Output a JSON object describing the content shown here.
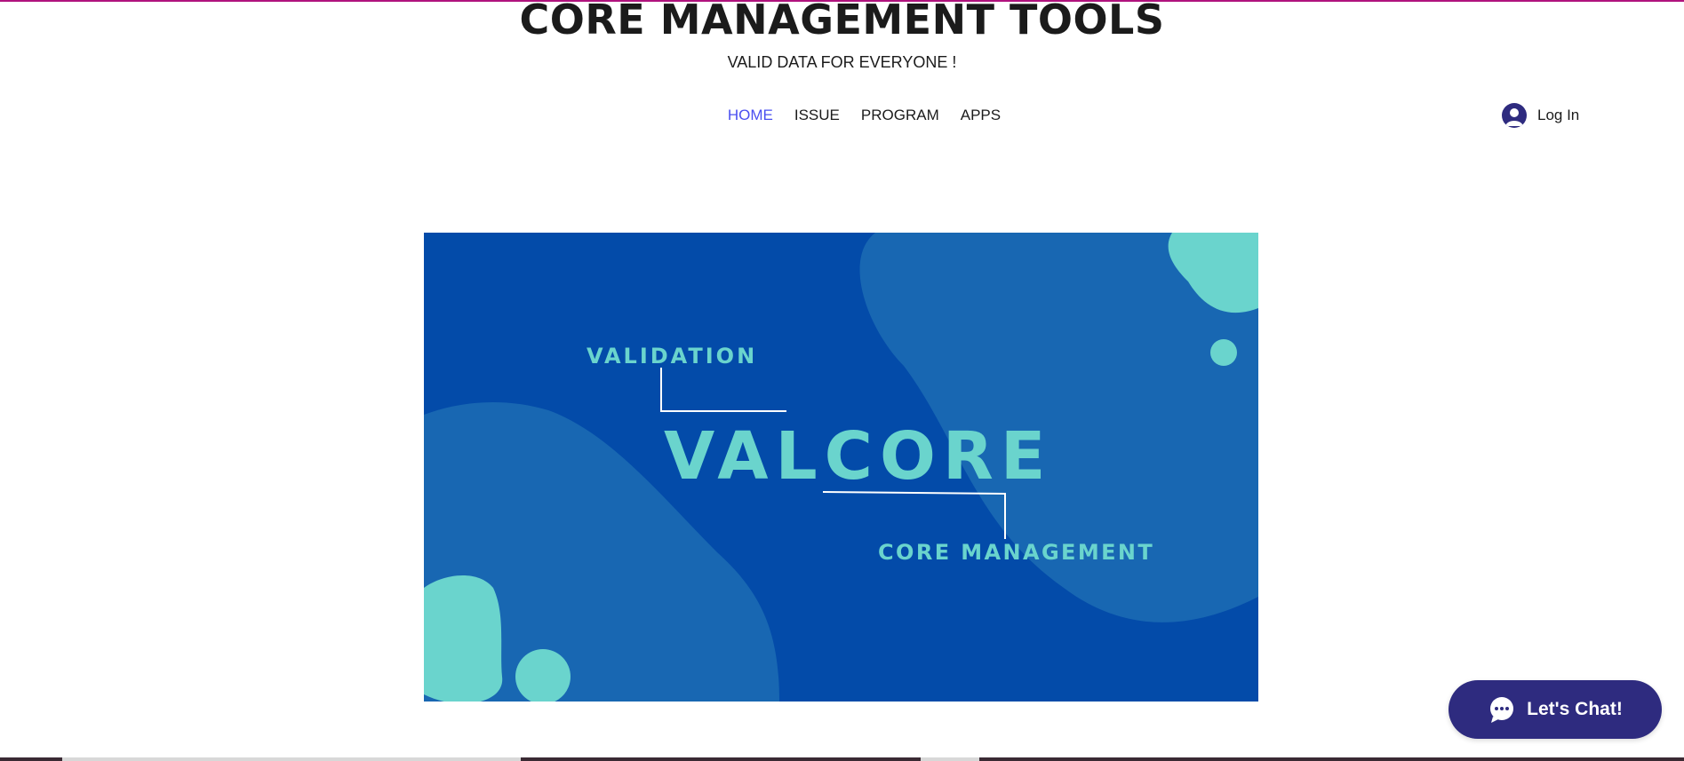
{
  "header": {
    "title": "CORE MANAGEMENT TOOLS",
    "subtitle": "VALID DATA FOR EVERYONE !"
  },
  "nav": {
    "items": [
      {
        "label": "HOME",
        "active": true
      },
      {
        "label": "ISSUE",
        "active": false
      },
      {
        "label": "PROGRAM",
        "active": false
      },
      {
        "label": "APPS",
        "active": false
      }
    ]
  },
  "login": {
    "label": "Log In",
    "icon": "user-avatar-icon"
  },
  "hero": {
    "top_label": "VALIDATION",
    "main_word": "VALCORE",
    "bottom_label": "CORE MANAGEMENT"
  },
  "chat": {
    "label": "Let's Chat!",
    "icon": "chat-bubble-icon"
  },
  "colors": {
    "accent_line": "#b0127d",
    "nav_active": "#4a4ff0",
    "hero_bg": "#034ba9",
    "hero_blob": "#1867b2",
    "hero_teal": "#6ad4cd",
    "chat_bg": "#2e2b7f"
  }
}
